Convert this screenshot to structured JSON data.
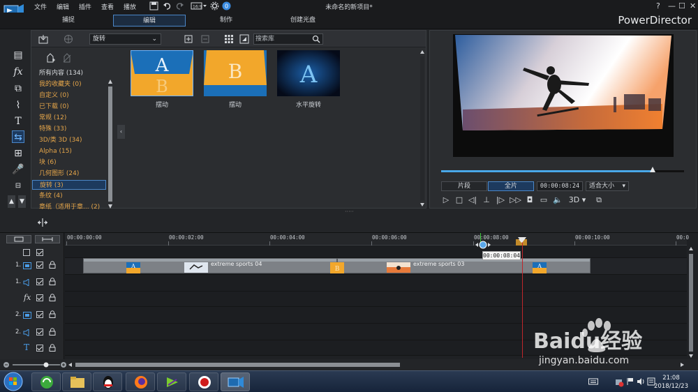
{
  "menu": [
    "文件",
    "编辑",
    "插件",
    "查看",
    "播放"
  ],
  "window_title": "未命名的新项目*",
  "window_controls": {
    "help": "?",
    "minimize": "—",
    "maximize": "☐",
    "close": "✕"
  },
  "modes": [
    "捕捉",
    "编辑",
    "制作",
    "创建光盘"
  ],
  "active_mode": "编辑",
  "brand": "PowerDirector",
  "library": {
    "category_select": "旋转",
    "search_placeholder": "搜索库",
    "categories": [
      {
        "label": "所有内容 (134)"
      },
      {
        "label": "我的收藏夹  (0)"
      },
      {
        "label": "自定义  (0)"
      },
      {
        "label": "已下载  (0)"
      },
      {
        "label": "常规  (12)"
      },
      {
        "label": "特殊  (33)"
      },
      {
        "label": "3D/类 3D  (34)"
      },
      {
        "label": "Alpha  (15)"
      },
      {
        "label": "块  (6)"
      },
      {
        "label": "几何图形  (24)"
      },
      {
        "label": "旋转  (3)"
      },
      {
        "label": "条纹  (4)"
      },
      {
        "label": "章纸（适用于章...  (2)"
      }
    ],
    "selected_category": "旋转  (3)",
    "items": [
      {
        "label": "摆动",
        "glyph": "A"
      },
      {
        "label": "摆动",
        "glyph": "B"
      },
      {
        "label": "水平旋转",
        "glyph": "A"
      }
    ]
  },
  "preview": {
    "tab_clip": "片段",
    "tab_movie": "全片",
    "timecode": "00:00:08:24",
    "fit": "适合大小",
    "mode_3d": "3D",
    "progress": 0.87
  },
  "timeline": {
    "ticks": [
      "00:00:00:00",
      "00:00:02:00",
      "00:00:04:00",
      "00:00:06:00",
      "00:00:08:00",
      "00:00:10:00",
      "00:0"
    ],
    "tooltip": "00:00:08:04",
    "tracks": [
      {
        "num": "1."
      },
      {
        "num": "1."
      },
      {
        "num": ""
      },
      {
        "num": "2."
      },
      {
        "num": "2."
      },
      {
        "num": ""
      }
    ],
    "clips": [
      {
        "label": "extreme sports 04"
      },
      {
        "label": "extreme sports 03"
      }
    ]
  },
  "taskbar": {
    "time": "21:08",
    "date": "2018/12/23"
  },
  "watermark": {
    "text": "Baidu经验",
    "sub": "jingyan.baidu.com"
  }
}
